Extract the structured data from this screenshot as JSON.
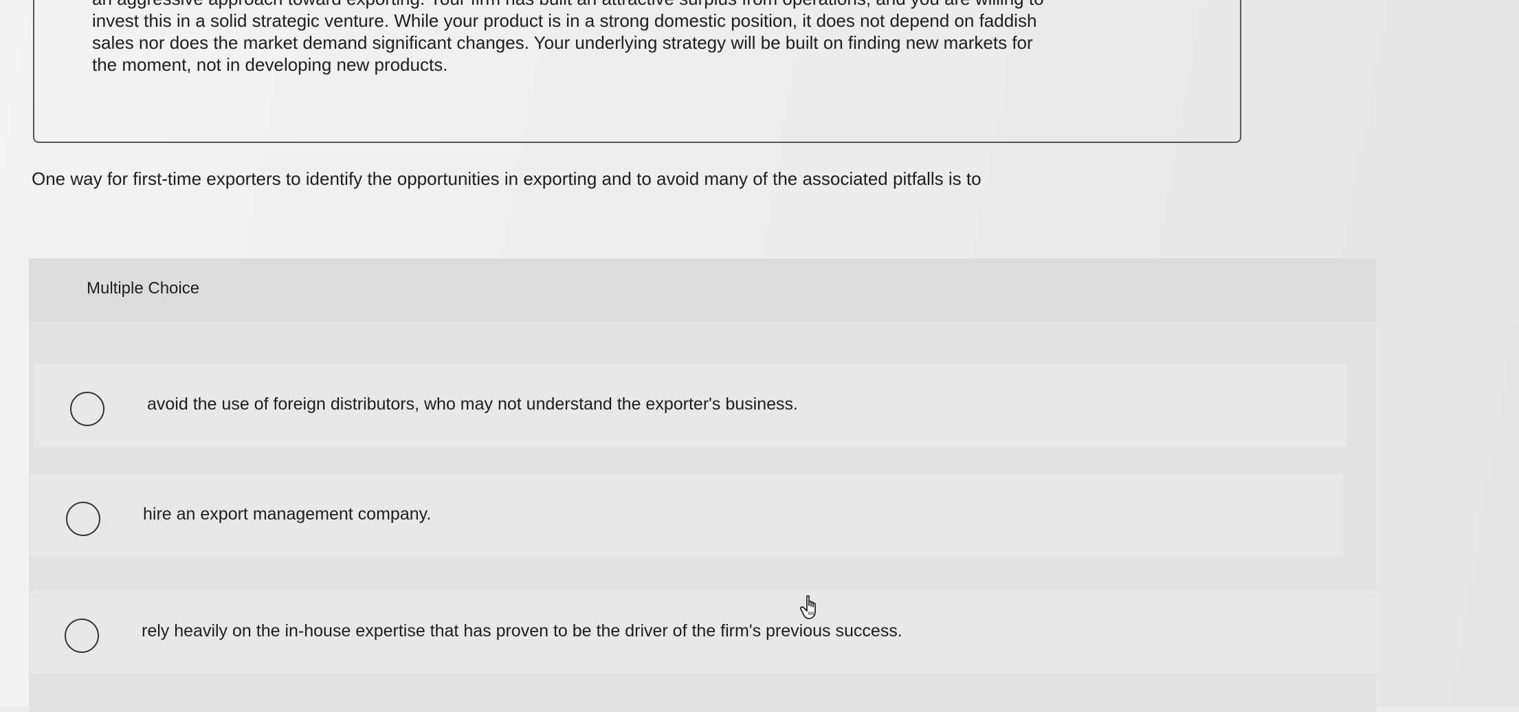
{
  "scenario": {
    "text": "an aggressive approach toward exporting. Your firm has built an attractive surplus from operations, and you are willing to\ninvest this in a solid strategic venture. While your product is in a strong domestic position, it does not depend on faddish\nsales nor does the market demand significant changes. Your underlying strategy will be built on finding new markets for\nthe moment, not in developing new products."
  },
  "question": {
    "stem": "One way for first-time exporters to identify the opportunities in exporting and to avoid many of the associated pitfalls is to"
  },
  "multiple_choice": {
    "label": "Multiple Choice",
    "options": [
      {
        "text": "avoid the use of foreign distributors, who may not understand the exporter's business.",
        "selected": false
      },
      {
        "text": "hire an export management company.",
        "selected": false
      },
      {
        "text": "rely heavily on the in-house expertise that has proven to be the driver of the firm's previous success.",
        "selected": false
      }
    ]
  },
  "icons": {
    "radio": "radio-unchecked-icon",
    "cursor": "hand-pointer-icon"
  }
}
